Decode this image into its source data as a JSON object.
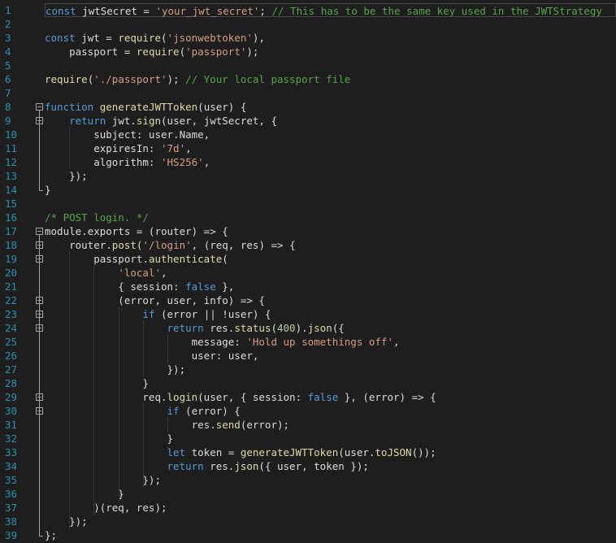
{
  "editor": {
    "line_numbers": [
      "1",
      "2",
      "3",
      "4",
      "5",
      "6",
      "7",
      "8",
      "9",
      "10",
      "11",
      "12",
      "13",
      "14",
      "15",
      "16",
      "17",
      "18",
      "19",
      "20",
      "21",
      "22",
      "23",
      "24",
      "25",
      "26",
      "27",
      "28",
      "29",
      "30",
      "31",
      "32",
      "33",
      "34",
      "35",
      "36",
      "37",
      "38",
      "39"
    ],
    "lines": [
      [
        {
          "t": "kw",
          "v": "const"
        },
        {
          "t": "id",
          "v": " jwtSecret = "
        },
        {
          "t": "str",
          "v": "'your_jwt_secret'"
        },
        {
          "t": "id",
          "v": "; "
        },
        {
          "t": "cmt",
          "v": "// This has to be the same key used in the JWTStrategy"
        }
      ],
      [],
      [
        {
          "t": "kw",
          "v": "const"
        },
        {
          "t": "id",
          "v": " jwt = "
        },
        {
          "t": "fn",
          "v": "require"
        },
        {
          "t": "id",
          "v": "("
        },
        {
          "t": "str",
          "v": "'jsonwebtoken'"
        },
        {
          "t": "id",
          "v": "),"
        }
      ],
      [
        {
          "t": "id",
          "v": "    passport = "
        },
        {
          "t": "fn",
          "v": "require"
        },
        {
          "t": "id",
          "v": "("
        },
        {
          "t": "str",
          "v": "'passport'"
        },
        {
          "t": "id",
          "v": ");"
        }
      ],
      [],
      [
        {
          "t": "fn",
          "v": "require"
        },
        {
          "t": "id",
          "v": "("
        },
        {
          "t": "str",
          "v": "'./passport'"
        },
        {
          "t": "id",
          "v": "); "
        },
        {
          "t": "cmt",
          "v": "// Your local passport file"
        }
      ],
      [],
      [
        {
          "t": "kw",
          "v": "function"
        },
        {
          "t": "id",
          "v": " "
        },
        {
          "t": "fn",
          "v": "generateJWTToken"
        },
        {
          "t": "id",
          "v": "(user) {"
        }
      ],
      [
        {
          "t": "id",
          "v": "    "
        },
        {
          "t": "kw",
          "v": "return"
        },
        {
          "t": "id",
          "v": " jwt."
        },
        {
          "t": "fn",
          "v": "sign"
        },
        {
          "t": "id",
          "v": "(user, jwtSecret, {"
        }
      ],
      [
        {
          "t": "id",
          "v": "        subject: user.Name,"
        }
      ],
      [
        {
          "t": "id",
          "v": "        expiresIn: "
        },
        {
          "t": "str",
          "v": "'7d'"
        },
        {
          "t": "id",
          "v": ","
        }
      ],
      [
        {
          "t": "id",
          "v": "        algorithm: "
        },
        {
          "t": "str",
          "v": "'HS256'"
        },
        {
          "t": "id",
          "v": ","
        }
      ],
      [
        {
          "t": "id",
          "v": "    });"
        }
      ],
      [
        {
          "t": "id",
          "v": "}"
        }
      ],
      [],
      [
        {
          "t": "cmt",
          "v": "/* POST login. */"
        }
      ],
      [
        {
          "t": "id",
          "v": "module.exports = (router) => {"
        }
      ],
      [
        {
          "t": "id",
          "v": "    router."
        },
        {
          "t": "fn",
          "v": "post"
        },
        {
          "t": "id",
          "v": "("
        },
        {
          "t": "str",
          "v": "'/login'"
        },
        {
          "t": "id",
          "v": ", (req, res) => {"
        }
      ],
      [
        {
          "t": "id",
          "v": "        passport."
        },
        {
          "t": "fn",
          "v": "authenticate"
        },
        {
          "t": "id",
          "v": "("
        }
      ],
      [
        {
          "t": "id",
          "v": "            "
        },
        {
          "t": "str",
          "v": "'local'"
        },
        {
          "t": "id",
          "v": ","
        }
      ],
      [
        {
          "t": "id",
          "v": "            { session: "
        },
        {
          "t": "kw",
          "v": "false"
        },
        {
          "t": "id",
          "v": " },"
        }
      ],
      [
        {
          "t": "id",
          "v": "            (error, user, info) => {"
        }
      ],
      [
        {
          "t": "id",
          "v": "                "
        },
        {
          "t": "kw",
          "v": "if"
        },
        {
          "t": "id",
          "v": " (error || !user) {"
        }
      ],
      [
        {
          "t": "id",
          "v": "                    "
        },
        {
          "t": "kw",
          "v": "return"
        },
        {
          "t": "id",
          "v": " res."
        },
        {
          "t": "fn",
          "v": "status"
        },
        {
          "t": "id",
          "v": "("
        },
        {
          "t": "num",
          "v": "400"
        },
        {
          "t": "id",
          "v": ")."
        },
        {
          "t": "fn",
          "v": "json"
        },
        {
          "t": "id",
          "v": "({"
        }
      ],
      [
        {
          "t": "id",
          "v": "                        message: "
        },
        {
          "t": "str",
          "v": "'Hold up somethings off'"
        },
        {
          "t": "id",
          "v": ","
        }
      ],
      [
        {
          "t": "id",
          "v": "                        user: user,"
        }
      ],
      [
        {
          "t": "id",
          "v": "                    });"
        }
      ],
      [
        {
          "t": "id",
          "v": "                }"
        }
      ],
      [
        {
          "t": "id",
          "v": "                req."
        },
        {
          "t": "fn",
          "v": "login"
        },
        {
          "t": "id",
          "v": "(user, { session: "
        },
        {
          "t": "kw",
          "v": "false"
        },
        {
          "t": "id",
          "v": " }, (error) => {"
        }
      ],
      [
        {
          "t": "id",
          "v": "                    "
        },
        {
          "t": "kw",
          "v": "if"
        },
        {
          "t": "id",
          "v": " (error) {"
        }
      ],
      [
        {
          "t": "id",
          "v": "                        res."
        },
        {
          "t": "fn",
          "v": "send"
        },
        {
          "t": "id",
          "v": "(error);"
        }
      ],
      [
        {
          "t": "id",
          "v": "                    }"
        }
      ],
      [
        {
          "t": "id",
          "v": "                    "
        },
        {
          "t": "kw",
          "v": "let"
        },
        {
          "t": "id",
          "v": " token = "
        },
        {
          "t": "fn",
          "v": "generateJWTToken"
        },
        {
          "t": "id",
          "v": "(user."
        },
        {
          "t": "fn",
          "v": "toJSON"
        },
        {
          "t": "id",
          "v": "());"
        }
      ],
      [
        {
          "t": "id",
          "v": "                    "
        },
        {
          "t": "kw",
          "v": "return"
        },
        {
          "t": "id",
          "v": " res."
        },
        {
          "t": "fn",
          "v": "json"
        },
        {
          "t": "id",
          "v": "({ user, token });"
        }
      ],
      [
        {
          "t": "id",
          "v": "                });"
        }
      ],
      [
        {
          "t": "id",
          "v": "            }"
        }
      ],
      [
        {
          "t": "id",
          "v": "        )(req, res);"
        }
      ],
      [
        {
          "t": "id",
          "v": "    });"
        }
      ],
      [
        {
          "t": "id",
          "v": "};"
        }
      ]
    ],
    "colors": {
      "background": "#1e1e1e",
      "line_number": "#2b91af",
      "keyword": "#569cd6",
      "string": "#d69d85",
      "comment": "#57a64a",
      "number": "#b5cea8",
      "function": "#dcdcaa",
      "text": "#dcdcdc"
    }
  }
}
